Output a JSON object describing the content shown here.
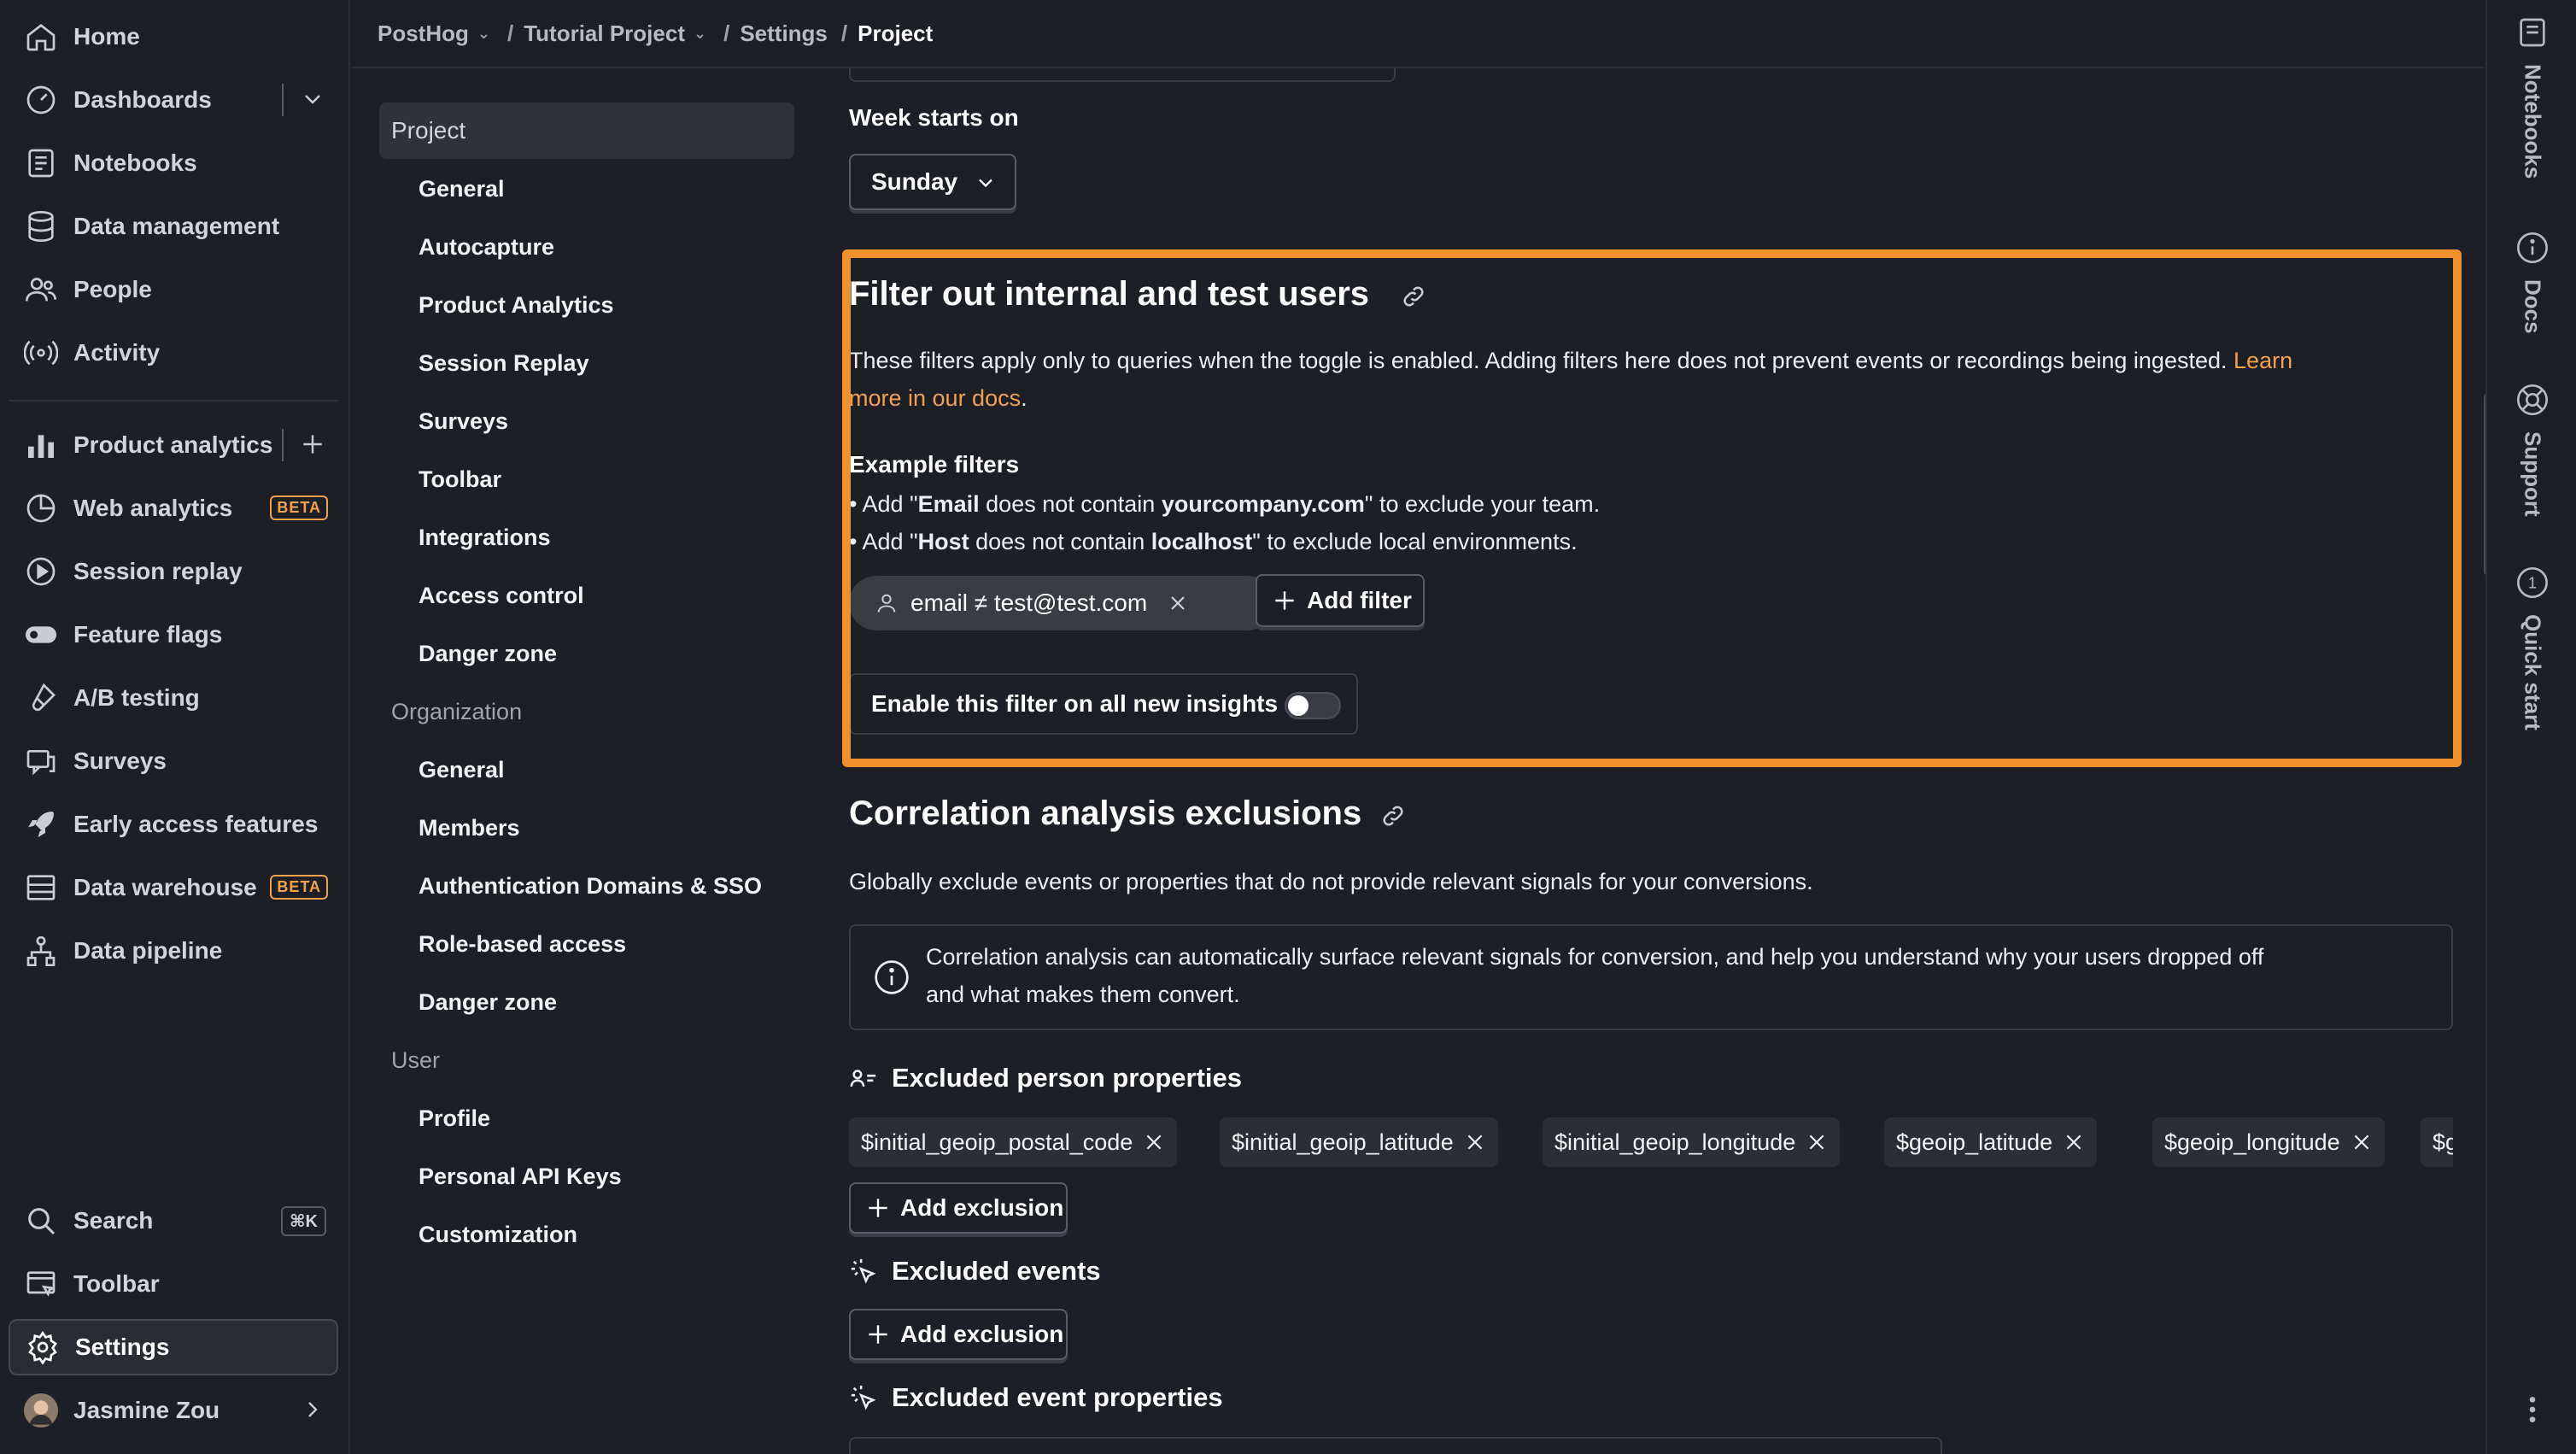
{
  "left_nav": {
    "items": [
      {
        "label": "Home",
        "icon": "home-icon"
      },
      {
        "label": "Dashboards",
        "icon": "dashboard-icon"
      },
      {
        "label": "Notebooks",
        "icon": "notebook-icon"
      },
      {
        "label": "Data management",
        "icon": "database-icon"
      },
      {
        "label": "People",
        "icon": "people-icon"
      },
      {
        "label": "Activity",
        "icon": "activity-icon"
      },
      {
        "label": "Product analytics",
        "icon": "bar-chart-icon"
      },
      {
        "label": "Web analytics",
        "icon": "pie-chart-icon",
        "badge": "BETA"
      },
      {
        "label": "Session replay",
        "icon": "replay-icon"
      },
      {
        "label": "Feature flags",
        "icon": "toggle-icon"
      },
      {
        "label": "A/B testing",
        "icon": "flask-icon"
      },
      {
        "label": "Surveys",
        "icon": "chat-icon"
      },
      {
        "label": "Early access features",
        "icon": "rocket-icon"
      },
      {
        "label": "Data warehouse",
        "icon": "warehouse-icon",
        "badge": "BETA"
      },
      {
        "label": "Data pipeline",
        "icon": "pipeline-icon"
      }
    ],
    "bottom_items": [
      {
        "label": "Search",
        "icon": "search-icon",
        "shortcut": "⌘K"
      },
      {
        "label": "Toolbar",
        "icon": "toolbar-icon"
      },
      {
        "label": "Settings",
        "icon": "gear-icon"
      }
    ],
    "user": {
      "name": "Jasmine Zou"
    }
  },
  "breadcrumb": {
    "items": [
      "PostHog",
      "Tutorial Project",
      "Settings",
      "Project"
    ],
    "separator": "/"
  },
  "settings_menu": {
    "project_heading": "Project",
    "project_items": [
      "General",
      "Autocapture",
      "Product Analytics",
      "Session Replay",
      "Surveys",
      "Toolbar",
      "Integrations",
      "Access control",
      "Danger zone"
    ],
    "org_heading": "Organization",
    "org_items": [
      "General",
      "Members",
      "Authentication Domains & SSO",
      "Role-based access",
      "Danger zone"
    ],
    "user_heading": "User",
    "user_items": [
      "Profile",
      "Personal API Keys",
      "Customization"
    ]
  },
  "week_start": {
    "label": "Week starts on",
    "value": "Sunday"
  },
  "filter_section": {
    "title": "Filter out internal and test users",
    "description": "These filters apply only to queries when the toggle is enabled. Adding filters here does not prevent events or recordings being ingested.",
    "link_text_1": "Learn",
    "link_text_2": "more in our docs",
    "period": ".",
    "example_heading": "Example filters",
    "example_1": {
      "prefix": "Add \"",
      "key": "Email",
      "mid": " does not contain ",
      "value": "yourcompany.com",
      "suffix": "\" to exclude your team."
    },
    "example_2": {
      "prefix": "Add \"",
      "key": "Host",
      "mid": " does not contain ",
      "value": "localhost",
      "suffix": "\" to exclude local environments."
    },
    "existing_filter": "email ≠ test@test.com",
    "add_filter_label": "Add filter",
    "toggle_label": "Enable this filter on all new insights",
    "toggle_on": false
  },
  "correlation_section": {
    "title": "Correlation analysis exclusions",
    "description": "Globally exclude events or properties that do not provide relevant signals for your conversions.",
    "info_line_1": "Correlation analysis can automatically surface relevant signals for conversion, and help you understand why your users dropped off",
    "info_line_2": "and what makes them convert.",
    "person_props_heading": "Excluded person properties",
    "person_props": [
      "$initial_geoip_postal_code",
      "$initial_geoip_latitude",
      "$initial_geoip_longitude",
      "$geoip_latitude",
      "$geoip_longitude",
      "$geo"
    ],
    "add_exclusion_label": "Add exclusion",
    "events_heading": "Excluded events",
    "event_props_heading": "Excluded event properties"
  },
  "right_rail": {
    "items": [
      "Notebooks",
      "Docs",
      "Support",
      "Quick start"
    ]
  },
  "colors": {
    "accent": "#f0912e",
    "link": "#f4a24a",
    "background": "#1d1f27"
  }
}
